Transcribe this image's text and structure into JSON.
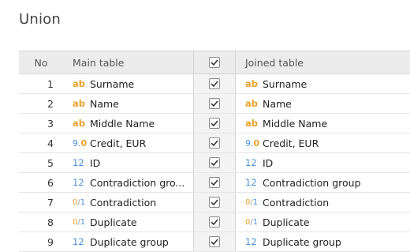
{
  "title": "Union",
  "columns": {
    "no": "No",
    "main": "Main table",
    "joined": "Joined table"
  },
  "rows": [
    {
      "no": "1",
      "main_type": "ab",
      "main": "Surname",
      "checked": true,
      "joined_type": "ab",
      "joined": "Surname"
    },
    {
      "no": "2",
      "main_type": "ab",
      "main": "Name",
      "checked": true,
      "joined_type": "ab",
      "joined": "Name"
    },
    {
      "no": "3",
      "main_type": "ab",
      "main": "Middle Name",
      "checked": true,
      "joined_type": "ab",
      "joined": "Middle Name"
    },
    {
      "no": "4",
      "main_type": "9.0",
      "main": "Credit, EUR",
      "checked": true,
      "joined_type": "9.0",
      "joined": "Credit, EUR"
    },
    {
      "no": "5",
      "main_type": "12",
      "main": "ID",
      "checked": true,
      "joined_type": "12",
      "joined": "ID"
    },
    {
      "no": "6",
      "main_type": "12",
      "main": "Contradiction gro...",
      "checked": true,
      "joined_type": "12",
      "joined": "Contradiction group"
    },
    {
      "no": "7",
      "main_type": "0/1",
      "main": "Contradiction",
      "checked": true,
      "joined_type": "0/1",
      "joined": "Contradiction"
    },
    {
      "no": "8",
      "main_type": "0/1",
      "main": "Duplicate",
      "checked": true,
      "joined_type": "0/1",
      "joined": "Duplicate"
    },
    {
      "no": "9",
      "main_type": "12",
      "main": "Duplicate group",
      "checked": true,
      "joined_type": "12",
      "joined": "Duplicate group"
    }
  ],
  "colors": {
    "text_type": "#e8a32e",
    "number_type": "#4a90d9",
    "header_bg": "#ececec"
  },
  "icons": {
    "check": "checkmark-icon"
  }
}
